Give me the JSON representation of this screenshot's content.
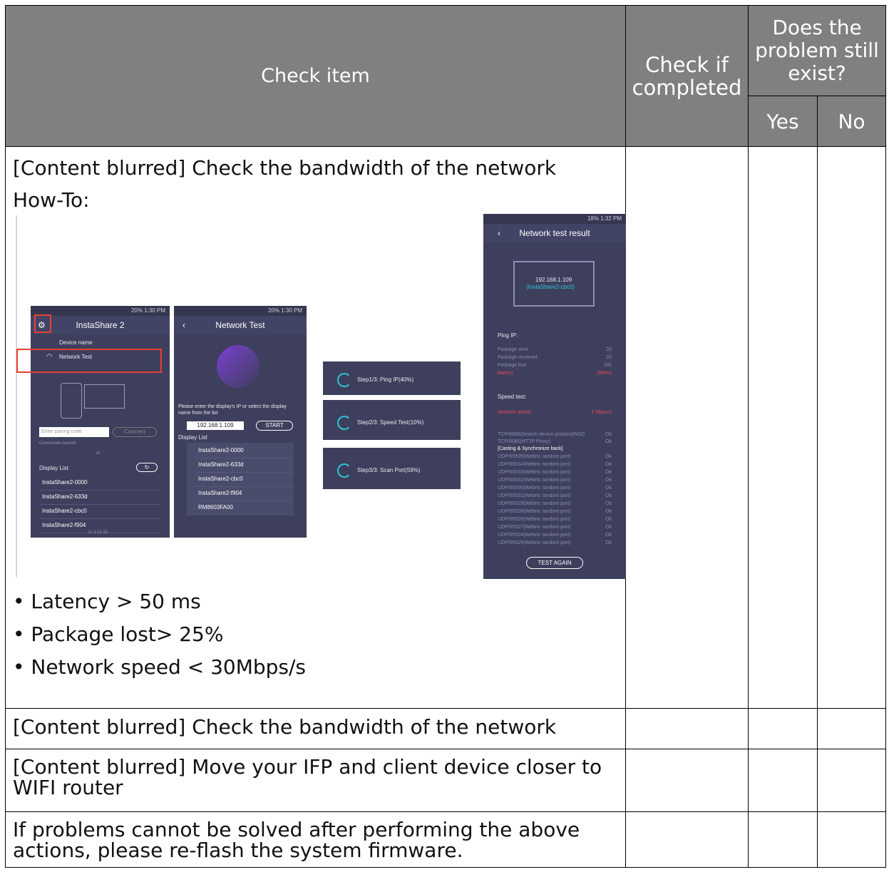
{
  "header": {
    "check_item": "Check item",
    "check_if_completed": "Check if completed",
    "still_exist": "Does the problem still exist?",
    "yes": "Yes",
    "no": "No"
  },
  "rows": [
    {
      "title": "[Content blurred] Check the bandwidth of the network",
      "howto": "How-To:",
      "bullets": [
        "• Latency > 50 ms",
        "• Package lost> 25%",
        "• Network speed < 30Mbps/s"
      ]
    },
    {
      "title": "[Content blurred] Check the bandwidth of the network"
    },
    {
      "title": "[Content blurred] Move your IFP and client device closer to WIFI router"
    },
    {
      "title": "If problems cannot be solved after performing the above actions, please re-flash the system firmware."
    }
  ],
  "screens": {
    "app": {
      "status": "20% 1:30 PM",
      "title": "InstaShare 2",
      "device_name": "Device name",
      "network_test": "Network Test",
      "pairing_placeholder": "Enter pairing code",
      "connect": "Connect",
      "connection_records": "Connection records",
      "or": "or",
      "display_list": "Display List",
      "devices": [
        "InstaShare2-0000",
        "InstaShare2-633d",
        "InstaShare2-cbc0",
        "InstaShare2-f904"
      ],
      "version": "v1.3.10.10"
    },
    "network_test": {
      "status": "20% 1:30 PM",
      "title": "Network Test",
      "prompt": "Please enter the display's IP or select the display name from the list",
      "ip": "192.168.1.109",
      "start": "START",
      "display_list": "Display List",
      "devices": [
        "InstaShare2-0000",
        "InstaShare2-633d",
        "InstaShare2-cbc0",
        "InstaShare2-f904",
        "RM8603FA00"
      ]
    },
    "steps": [
      "Step1/3: Ping IP(40%)",
      "Step2/3: Speed Test(10%)",
      "Step3/3: Scan Port(59%)"
    ],
    "result": {
      "status": "18% 1:32 PM",
      "title": "Network test result",
      "ip": "192.168.1.109",
      "name": "(InstaShare2-cbc0)",
      "ping_ip": "Ping IP:",
      "ping_rows": [
        {
          "label": "Package sent",
          "value": "20"
        },
        {
          "label": "Package received",
          "value": "20"
        },
        {
          "label": "Package lost",
          "value": "0%"
        },
        {
          "label": "latency",
          "value": "299ms"
        }
      ],
      "speed_test": "Speed test:",
      "network_speed": "Network speed",
      "network_speed_value": "5 Mbps/s",
      "ports_top": [
        {
          "label": "TCP/8888(Search device protocol(NSD",
          "value": "Ok"
        },
        {
          "label": "TCP/8080(HTTP Proxy)",
          "value": "Ok"
        }
      ],
      "casting": "[Casting & Synchronize back]",
      "ports": [
        {
          "label": "UDP/65535(Webrtc random port)",
          "value": "Ok"
        },
        {
          "label": "UDP/65534(Webrtc random port)",
          "value": "Ok"
        },
        {
          "label": "UDP/65533(Webrtc random port)",
          "value": "Ok"
        },
        {
          "label": "UDP/65532(Webrtc random port)",
          "value": "Ok"
        },
        {
          "label": "UDP/65530(Webrtc random port)",
          "value": "Ok"
        },
        {
          "label": "UDP/65531(Webrtc random port)",
          "value": "Ok"
        },
        {
          "label": "UDP/65529(Webrtc random port)",
          "value": "Ok"
        },
        {
          "label": "UDP/65528(Webrtc random port)",
          "value": "Ok"
        },
        {
          "label": "UDP/65526(Webrtc random port)",
          "value": "Ok"
        },
        {
          "label": "UDP/65527(Webrtc random port)",
          "value": "Ok"
        },
        {
          "label": "UDP/65524(Webrtc random port)",
          "value": "Ok"
        },
        {
          "label": "UDP/65525(Webrtc random port)",
          "value": "Ok"
        }
      ],
      "test_again": "TEST AGAIN"
    }
  }
}
